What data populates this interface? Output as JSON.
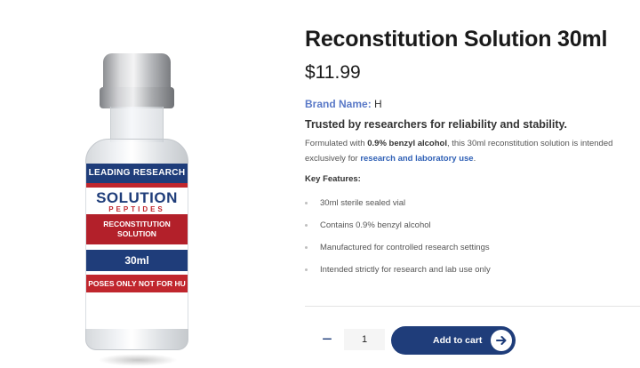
{
  "product": {
    "title": "Reconstitution Solution 30ml",
    "price": "$11.99",
    "brand_label": "Brand Name:",
    "brand_value": "H",
    "tagline": "Trusted by researchers for reliability and stability.",
    "description": {
      "part1": "Formulated with ",
      "bold": "0.9% benzyl alcohol",
      "part2": ", this 30ml reconstitution solution is intended exclusively for ",
      "link": "research and laboratory use",
      "part3": "."
    },
    "key_features_title": "Key Features:",
    "key_features": [
      "30ml sterile sealed vial",
      "Contains 0.9% benzyl alcohol",
      "Manufactured for controlled research settings",
      "Intended strictly for research and lab use only"
    ]
  },
  "vial_label": {
    "top_band": "LEADING RESEARCH",
    "brand_main": "SOLUTION",
    "brand_sub": "PEPTIDES",
    "product_line1": "RECONSTITUTION",
    "product_line2": "SOLUTION",
    "volume": "30ml",
    "bottom_band": "POSES ONLY NOT FOR HU"
  },
  "cart": {
    "quantity": "1",
    "minus": "−",
    "plus": "+",
    "add_label": "Add to cart"
  },
  "colors": {
    "accent": "#1f3d7a",
    "brand_label": "#5a79c7",
    "link": "#2e5fb5",
    "label_red": "#c0262d"
  }
}
